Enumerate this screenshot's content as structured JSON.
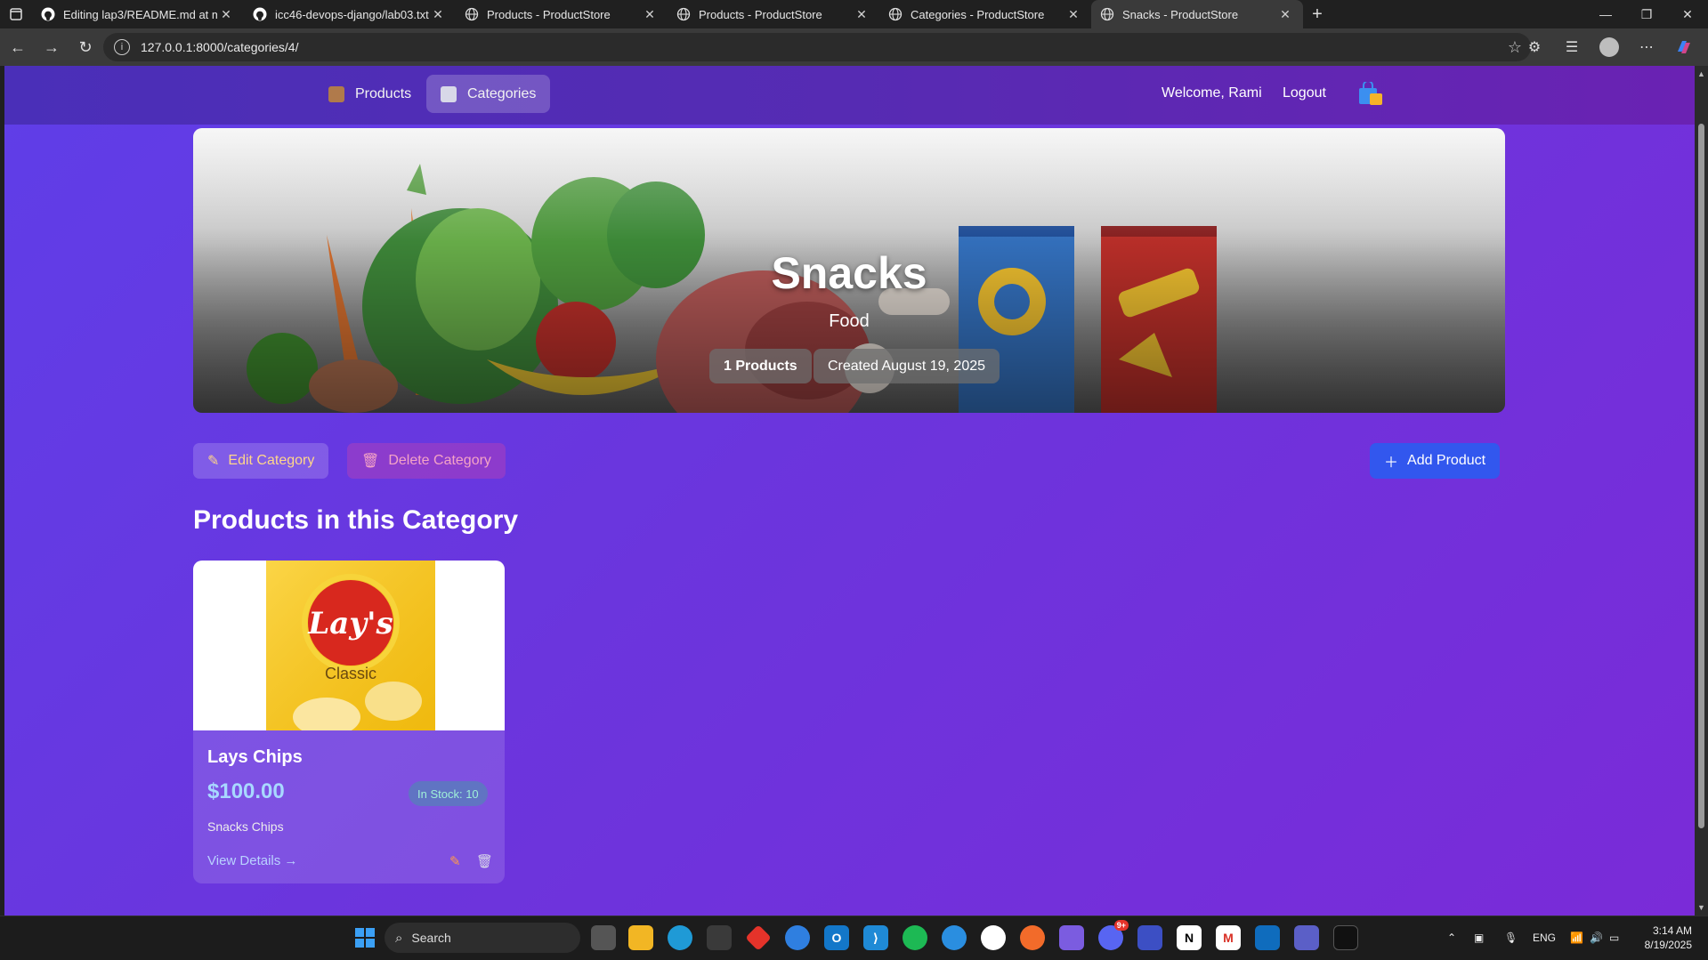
{
  "browser": {
    "tabs": [
      {
        "title": "Editing lap3/README.md at main",
        "icon": "github-icon",
        "active": false
      },
      {
        "title": "icc46-devops-django/lab03.txt at",
        "icon": "github-icon",
        "active": false
      },
      {
        "title": "Products - ProductStore",
        "icon": "globe-icon",
        "active": false
      },
      {
        "title": "Products - ProductStore",
        "icon": "globe-icon",
        "active": false
      },
      {
        "title": "Categories - ProductStore",
        "icon": "globe-icon",
        "active": false
      },
      {
        "title": "Snacks - ProductStore",
        "icon": "globe-icon",
        "active": true
      }
    ],
    "url": "127.0.0.1:8000/categories/4/"
  },
  "nav": {
    "products_label": "Products",
    "categories_label": "Categories",
    "welcome": "Welcome, Rami",
    "logout_label": "Logout"
  },
  "category": {
    "name": "Snacks",
    "parent": "Food",
    "product_count": "1 Products",
    "created": "Created August 19, 2025"
  },
  "actions": {
    "edit_label": "Edit Category",
    "delete_label": "Delete Category",
    "add_label": "Add Product"
  },
  "section": {
    "title": "Products in this Category"
  },
  "products": [
    {
      "name": "Lays Chips",
      "price": "$100.00",
      "stock": "In Stock: 10",
      "description": "Snacks Chips",
      "view_label": "View Details →",
      "image_text": "Classic",
      "brand_text": "Lay's"
    }
  ],
  "taskbar": {
    "search_placeholder": "Search",
    "lang": "ENG",
    "time": "3:14 AM",
    "date": "8/19/2025",
    "badge": "9+"
  },
  "colors": {
    "page_gradient_start": "#5f3ee8",
    "page_gradient_end": "#7a2bd8",
    "add_button": "#3257ee",
    "price": "#a8d8ff"
  }
}
